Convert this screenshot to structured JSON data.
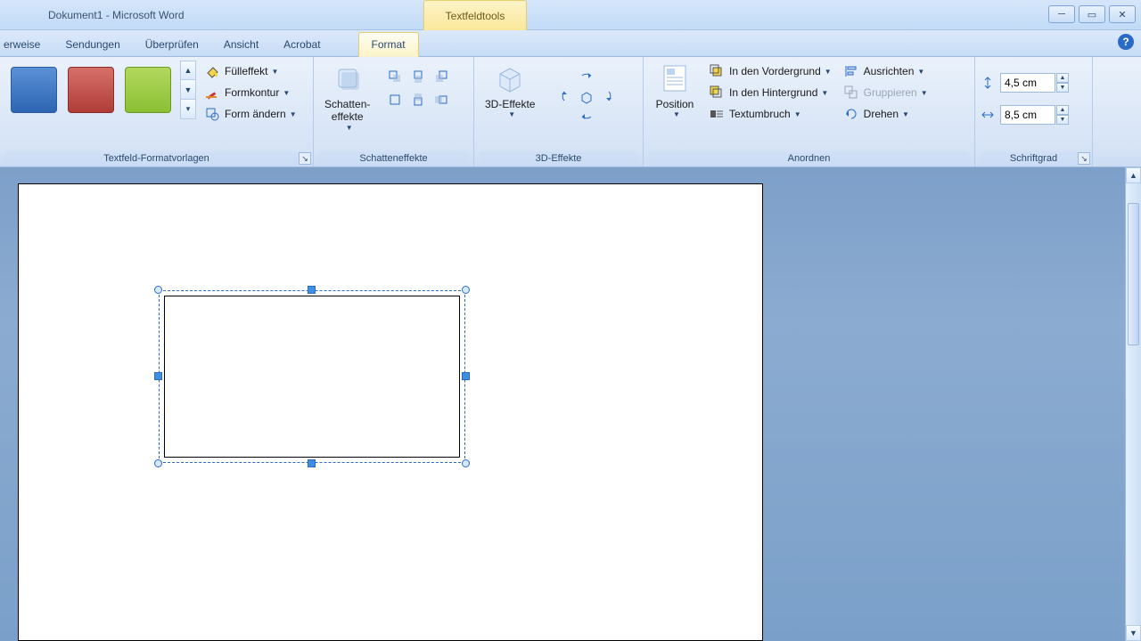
{
  "window": {
    "title": "Dokument1 - Microsoft Word",
    "contextual_group": "Textfeldtools"
  },
  "tabs": {
    "verweise": "erweise",
    "sendungen": "Sendungen",
    "uberprufen": "Überprüfen",
    "ansicht": "Ansicht",
    "acrobat": "Acrobat",
    "format": "Format"
  },
  "groups": {
    "styles": {
      "label": "Textfeld-Formatvorlagen",
      "fuell": "Fülleffekt",
      "kontur": "Formkontur",
      "form": "Form ändern"
    },
    "shadow": {
      "label": "Schatteneffekte",
      "btn": "Schatten-\neffekte"
    },
    "threeD": {
      "label": "3D-Effekte",
      "btn": "3D-Effekte"
    },
    "arrange": {
      "label": "Anordnen",
      "position": "Position",
      "front": "In den Vordergrund",
      "back": "In den Hintergrund",
      "wrap": "Textumbruch",
      "align": "Ausrichten",
      "group": "Gruppieren",
      "rotate": "Drehen"
    },
    "size": {
      "label": "Schriftgrad",
      "height": "4,5 cm",
      "width": "8,5 cm"
    }
  }
}
